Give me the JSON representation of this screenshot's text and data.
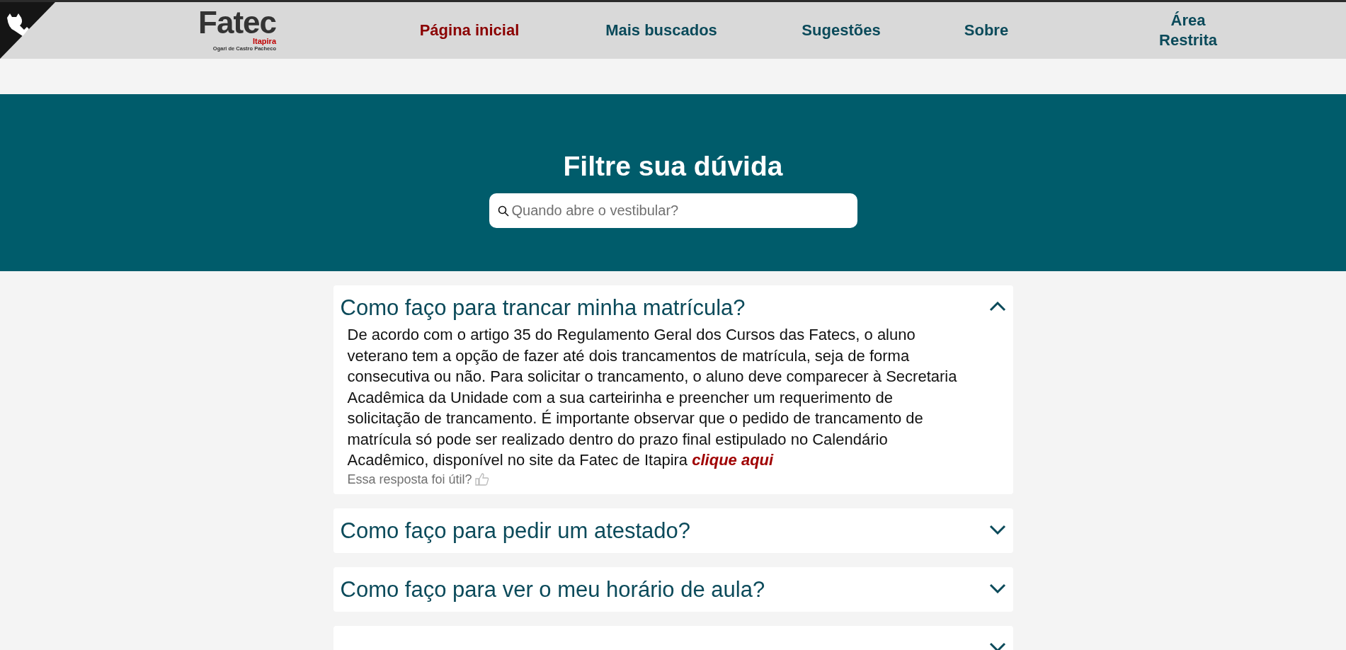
{
  "logo": {
    "name": "Fatec",
    "city": "Itapira",
    "subtitle": "Ogari de Castro Pacheco"
  },
  "nav": [
    {
      "label": "Página inicial",
      "selected": true
    },
    {
      "label": "Mais buscados",
      "selected": false
    },
    {
      "label": "Sugestões",
      "selected": false
    },
    {
      "label": "Sobre",
      "selected": false
    },
    {
      "label": "Área Restrita",
      "selected": false
    }
  ],
  "hero": {
    "title": "Filtre sua dúvida",
    "search": {
      "placeholder": "Quando abre o vestibular?"
    }
  },
  "faqs": [
    {
      "question": "Como faço para trancar minha matrícula?",
      "expanded": true,
      "answer": "De acordo com o artigo 35 do Regulamento Geral dos Cursos das Fatecs, o aluno veterano tem a opção de fazer até dois trancamentos de matrícula, seja de forma consecutiva ou não. Para solicitar o trancamento, o aluno deve comparecer à Secretaria Acadêmica da Unidade com a sua carteirinha e preencher um requerimento de solicitação de trancamento. É importante observar que o pedido de trancamento de matrícula só pode ser realizado dentro do prazo final estipulado no Calendário Acadêmico, disponível no site da Fatec de Itapira",
      "link": "clique aqui",
      "feedback": "Essa resposta foi útil?"
    },
    {
      "question": "Como faço para pedir um atestado?",
      "expanded": false
    },
    {
      "question": "Como faço para ver o meu horário de aula?",
      "expanded": false
    },
    {
      "expanded": false
    }
  ]
}
